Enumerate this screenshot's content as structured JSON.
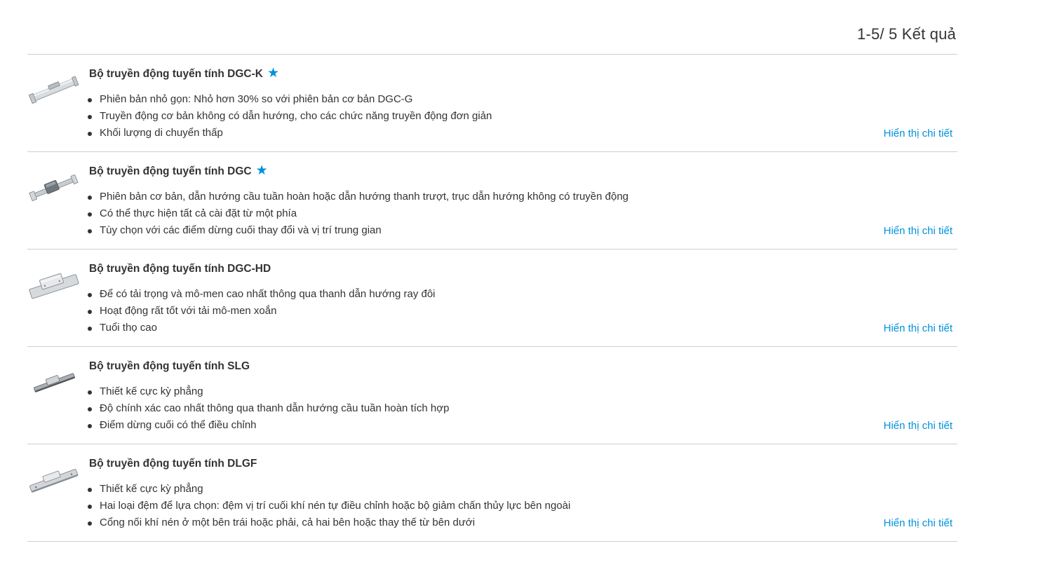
{
  "results": {
    "count_label": "1-5/ 5 Kết quả"
  },
  "colors": {
    "accent": "#0091dc",
    "text": "#333333",
    "divider": "#cfcfcf"
  },
  "products": [
    {
      "title": "Bộ truyền động tuyến tính DGC-K",
      "starred": true,
      "star_icon": "star-icon",
      "bullets": [
        "Phiên bản nhỏ gọn: Nhỏ hơn 30% so với phiên bản cơ bản DGC-G",
        "Truyền động cơ bản không có dẫn hướng, cho các chức năng truyền động đơn giản",
        "Khối lượng di chuyển thấp"
      ],
      "link_label": "Hiển thị chi tiết"
    },
    {
      "title": "Bộ truyền động tuyến tính DGC",
      "starred": true,
      "star_icon": "star-icon",
      "bullets": [
        "Phiên bản cơ bản, dẫn hướng cầu tuần hoàn hoặc dẫn hướng thanh trượt, trục dẫn hướng không có truyền động",
        "Có thể thực hiện tất cả cài đặt từ một phía",
        "Tùy chọn với các điểm dừng cuối thay đổi và vị trí trung gian"
      ],
      "link_label": "Hiển thị chi tiết"
    },
    {
      "title": "Bộ truyền động tuyến tính DGC-HD",
      "starred": false,
      "bullets": [
        "Để có tải trọng và mô-men cao nhất thông qua thanh dẫn hướng ray đôi",
        "Hoạt động rất tốt với tải mô-men xoắn",
        "Tuổi thọ cao"
      ],
      "link_label": "Hiển thị chi tiết"
    },
    {
      "title": "Bộ truyền động tuyến tính SLG",
      "starred": false,
      "bullets": [
        "Thiết kế cực kỳ phẳng",
        "Độ chính xác cao nhất thông qua thanh dẫn hướng cầu tuần hoàn tích hợp",
        "Điểm dừng cuối có thể điều chỉnh"
      ],
      "link_label": "Hiển thị chi tiết"
    },
    {
      "title": "Bộ truyền động tuyến tính DLGF",
      "starred": false,
      "bullets": [
        "Thiết kế cực kỳ phẳng",
        "Hai loại đệm để lựa chọn: đệm vị trí cuối khí nén tự điều chỉnh hoặc bộ giảm chấn thủy lực bên ngoài",
        "Cổng nối khí nén ở một bên trái hoặc phải, cả hai bên hoặc thay thế từ bên dưới"
      ],
      "link_label": "Hiển thị chi tiết"
    }
  ]
}
